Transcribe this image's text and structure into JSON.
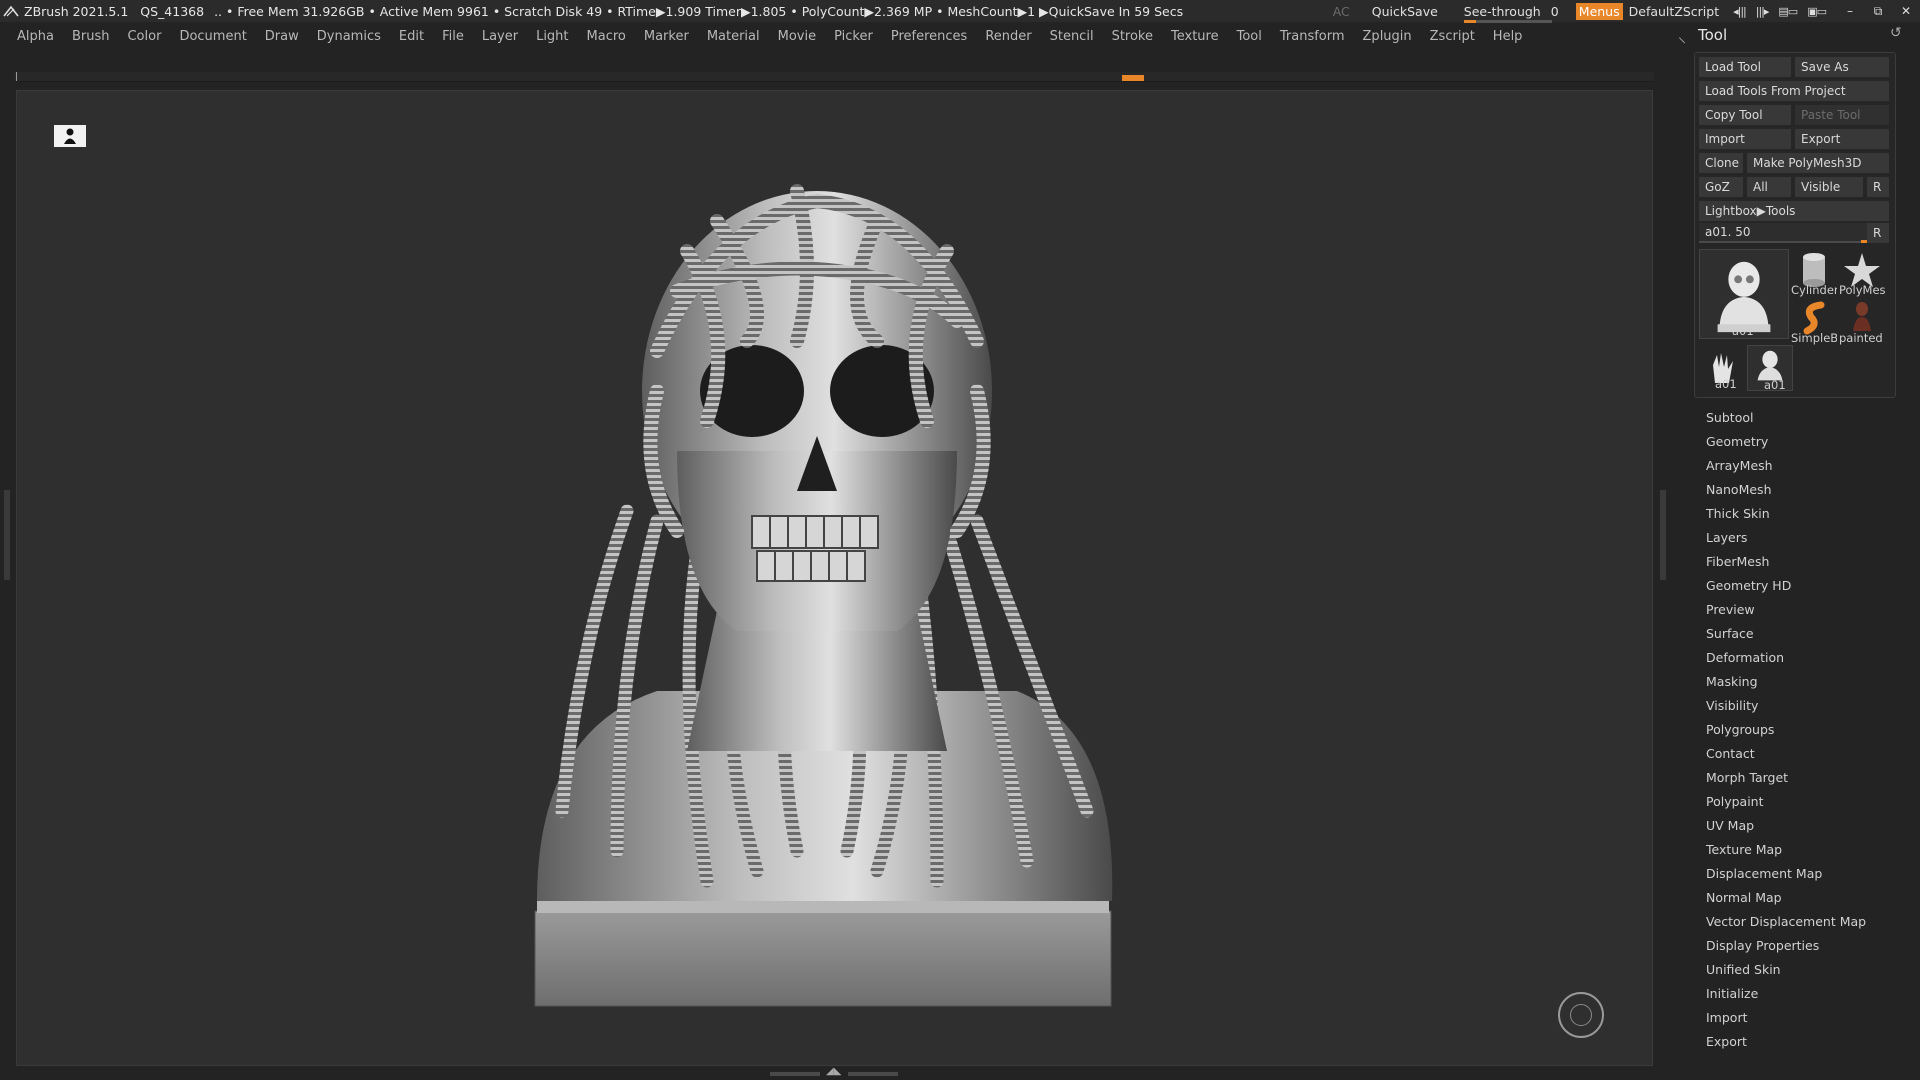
{
  "titlebar": {
    "app_title": "ZBrush 2021.5.1",
    "document": "QS_41368",
    "stats": ".. • Free Mem 31.926GB • Active Mem 9961 • Scratch Disk 49 • RTime▶1.909 Timer▶1.805 • PolyCount▶2.369 MP • MeshCount▶1  ▶QuickSave In 59 Secs",
    "ac": "AC",
    "quicksave": "QuickSave",
    "see_through_label": "See-through",
    "see_through_value": "0",
    "see_through_level": 0.0,
    "menus": "Menus",
    "default_zscript": "DefaultZScript",
    "window_minimize": "–",
    "window_restore": "⧉",
    "window_close": "✕"
  },
  "menubar": {
    "items": [
      "Alpha",
      "Brush",
      "Color",
      "Document",
      "Draw",
      "Dynamics",
      "Edit",
      "File",
      "Layer",
      "Light",
      "Macro",
      "Marker",
      "Material",
      "Movie",
      "Picker",
      "Preferences",
      "Render",
      "Stencil",
      "Stroke",
      "Texture",
      "Tool",
      "Transform",
      "Zplugin",
      "Zscript",
      "Help"
    ]
  },
  "tool_panel": {
    "title": "Tool",
    "buttons": {
      "load_tool": "Load Tool",
      "save_as": "Save As",
      "load_from_project": "Load Tools From Project",
      "copy_tool": "Copy Tool",
      "paste_tool": "Paste Tool",
      "import": "Import",
      "export": "Export",
      "clone": "Clone",
      "make_polymesh": "Make PolyMesh3D",
      "goz": "GoZ",
      "all": "All",
      "visible": "Visible",
      "r": "R",
      "lightbox_tools": "Lightbox▶Tools"
    },
    "slider": {
      "label": "a01. 50",
      "r": "R"
    },
    "thumbnails": {
      "main": "a01",
      "cylinder": "Cylinder",
      "polymesh": "PolyMes",
      "simpleb": "SimpleB",
      "painted": "painted",
      "small1": "a01",
      "small2": "a01"
    },
    "subpalettes": [
      "Subtool",
      "Geometry",
      "ArrayMesh",
      "NanoMesh",
      "Thick Skin",
      "Layers",
      "FiberMesh",
      "Geometry HD",
      "Preview",
      "Surface",
      "Deformation",
      "Masking",
      "Visibility",
      "Polygroups",
      "Contact",
      "Morph Target",
      "Polypaint",
      "UV Map",
      "Texture Map",
      "Displacement Map",
      "Normal Map",
      "Vector Displacement Map",
      "Display Properties",
      "Unified Skin",
      "Initialize",
      "Import",
      "Export"
    ]
  },
  "colors": {
    "accent": "#e8862a",
    "background": "#232323",
    "viewport": "#2f2f2f"
  }
}
